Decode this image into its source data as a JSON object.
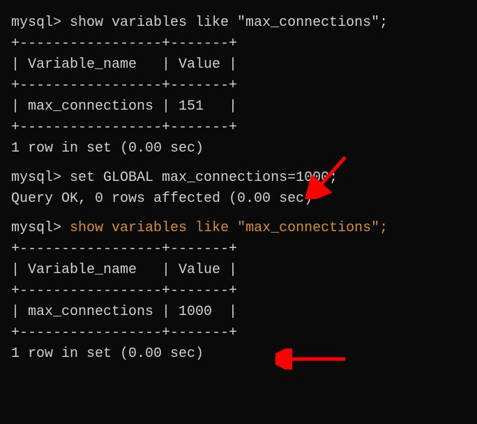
{
  "prompt": "mysql>",
  "query1": {
    "command": " show variables like \"max_connections\";",
    "table": {
      "border_top": "+-----------------+-------+",
      "header": "| Variable_name   | Value |",
      "border_mid": "+-----------------+-------+",
      "row": "| max_connections | 151   |",
      "border_bot": "+-----------------+-------+"
    },
    "summary": "1 row in set (0.00 sec)"
  },
  "query2": {
    "command": " set GLOBAL max_connections=1000;",
    "result": "Query OK, 0 rows affected (0.00 sec)"
  },
  "query3": {
    "command": "show variables like \"max_connections\";",
    "table": {
      "border_top": "+-----------------+-------+",
      "header": "| Variable_name   | Value |",
      "border_mid": "+-----------------+-------+",
      "row": "| max_connections | 1000  |",
      "border_bot": "+-----------------+-------+"
    },
    "summary": "1 row in set (0.00 sec)"
  },
  "annotations": {
    "arrow1_desc": "red-arrow-pointing-down-left",
    "arrow2_desc": "red-arrow-pointing-left"
  }
}
